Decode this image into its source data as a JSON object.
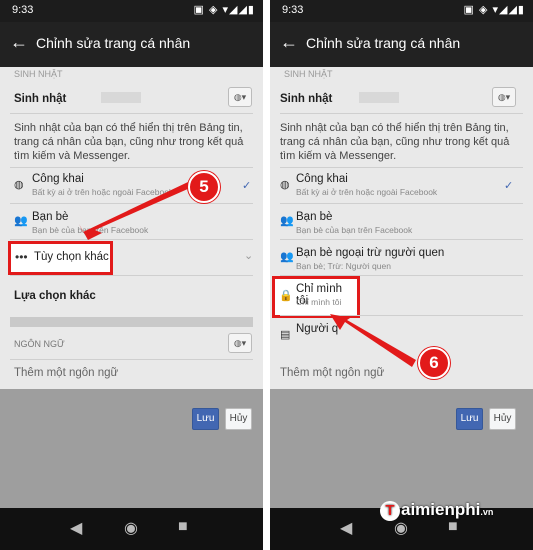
{
  "status_bar": {
    "time": "9:33",
    "icons": "▣ ◈ ▾◢◢▮"
  },
  "app_bar": {
    "title": "Chỉnh sửa trang cá nhân",
    "back_icon": "←"
  },
  "left": {
    "section_label": "SINH NHẬT",
    "birthday_label": "Sinh nhật",
    "birthday_desc": "Sinh nhật của bạn có thể hiển thị trên Bảng tin, trang cá nhân của bạn, cũng như trong kết quả tìm kiếm và Messenger.",
    "options": [
      {
        "title": "Công khai",
        "subtitle": "Bất kỳ ai ở trên hoặc ngoài Facebook"
      },
      {
        "title": "Bạn bè",
        "subtitle": "Bạn bè của bạn trên Facebook"
      },
      {
        "title": "Tùy chọn khác",
        "subtitle": ""
      }
    ],
    "other_choice": "Lựa chọn khác",
    "language_label": "NGÔN NGỮ",
    "add_language": "Thêm một ngôn ngữ",
    "save": "Lưu",
    "cancel": "Hủy",
    "step": "5"
  },
  "right": {
    "section_label": "SINH NHẬT",
    "birthday_label": "Sinh nhật",
    "birthday_desc": "Sinh nhật của bạn có thể hiển thị trên Bảng tin, trang cá nhân của bạn, cũng như trong kết quả tìm kiếm và Messenger.",
    "options": [
      {
        "title": "Công khai",
        "subtitle": "Bất kỳ ai ở trên hoặc ngoài Facebook"
      },
      {
        "title": "Bạn bè",
        "subtitle": "Bạn bè của bạn trên Facebook"
      },
      {
        "title": "Bạn bè ngoại trừ người quen",
        "subtitle": "Bạn bè; Trừ: Người quen"
      },
      {
        "title": "Chỉ mình tôi",
        "subtitle": "Chỉ mình tôi"
      },
      {
        "title": "Người q",
        "subtitle": ""
      }
    ],
    "add_language": "Thêm một ngôn ngữ",
    "save": "Lưu",
    "cancel": "Hủy",
    "step": "6"
  },
  "watermark": {
    "t": "T",
    "brand": "aimienphi",
    "tld": ".vn"
  },
  "colors": {
    "accent": "#4267b2",
    "highlight": "#e21a1a"
  }
}
